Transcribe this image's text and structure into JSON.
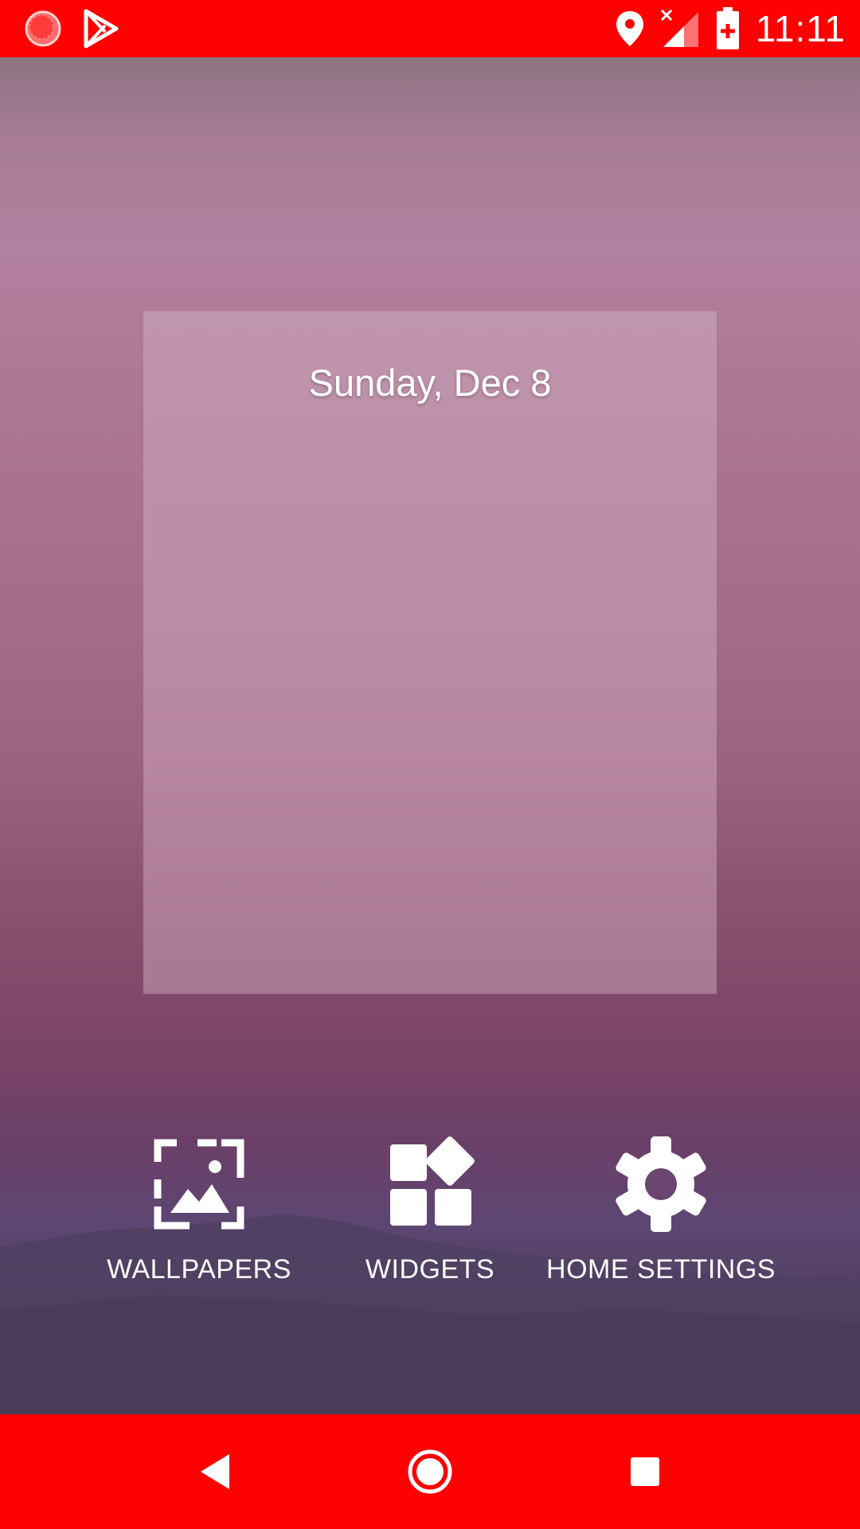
{
  "status_bar": {
    "time": "11:11",
    "left_icons": [
      "app-notification-icon",
      "play-store-icon"
    ],
    "right_icons": [
      "location-icon",
      "cell-signal-no-data-icon",
      "battery-charging-icon"
    ],
    "color": "#ff0000"
  },
  "preview": {
    "date": "Sunday, Dec 8"
  },
  "options": {
    "wallpapers_label": "WALLPAPERS",
    "widgets_label": "WIDGETS",
    "home_settings_label": "HOME SETTINGS"
  },
  "nav_bar": {
    "buttons": [
      "back-icon",
      "home-icon",
      "recents-icon"
    ],
    "color": "#ff0000"
  }
}
